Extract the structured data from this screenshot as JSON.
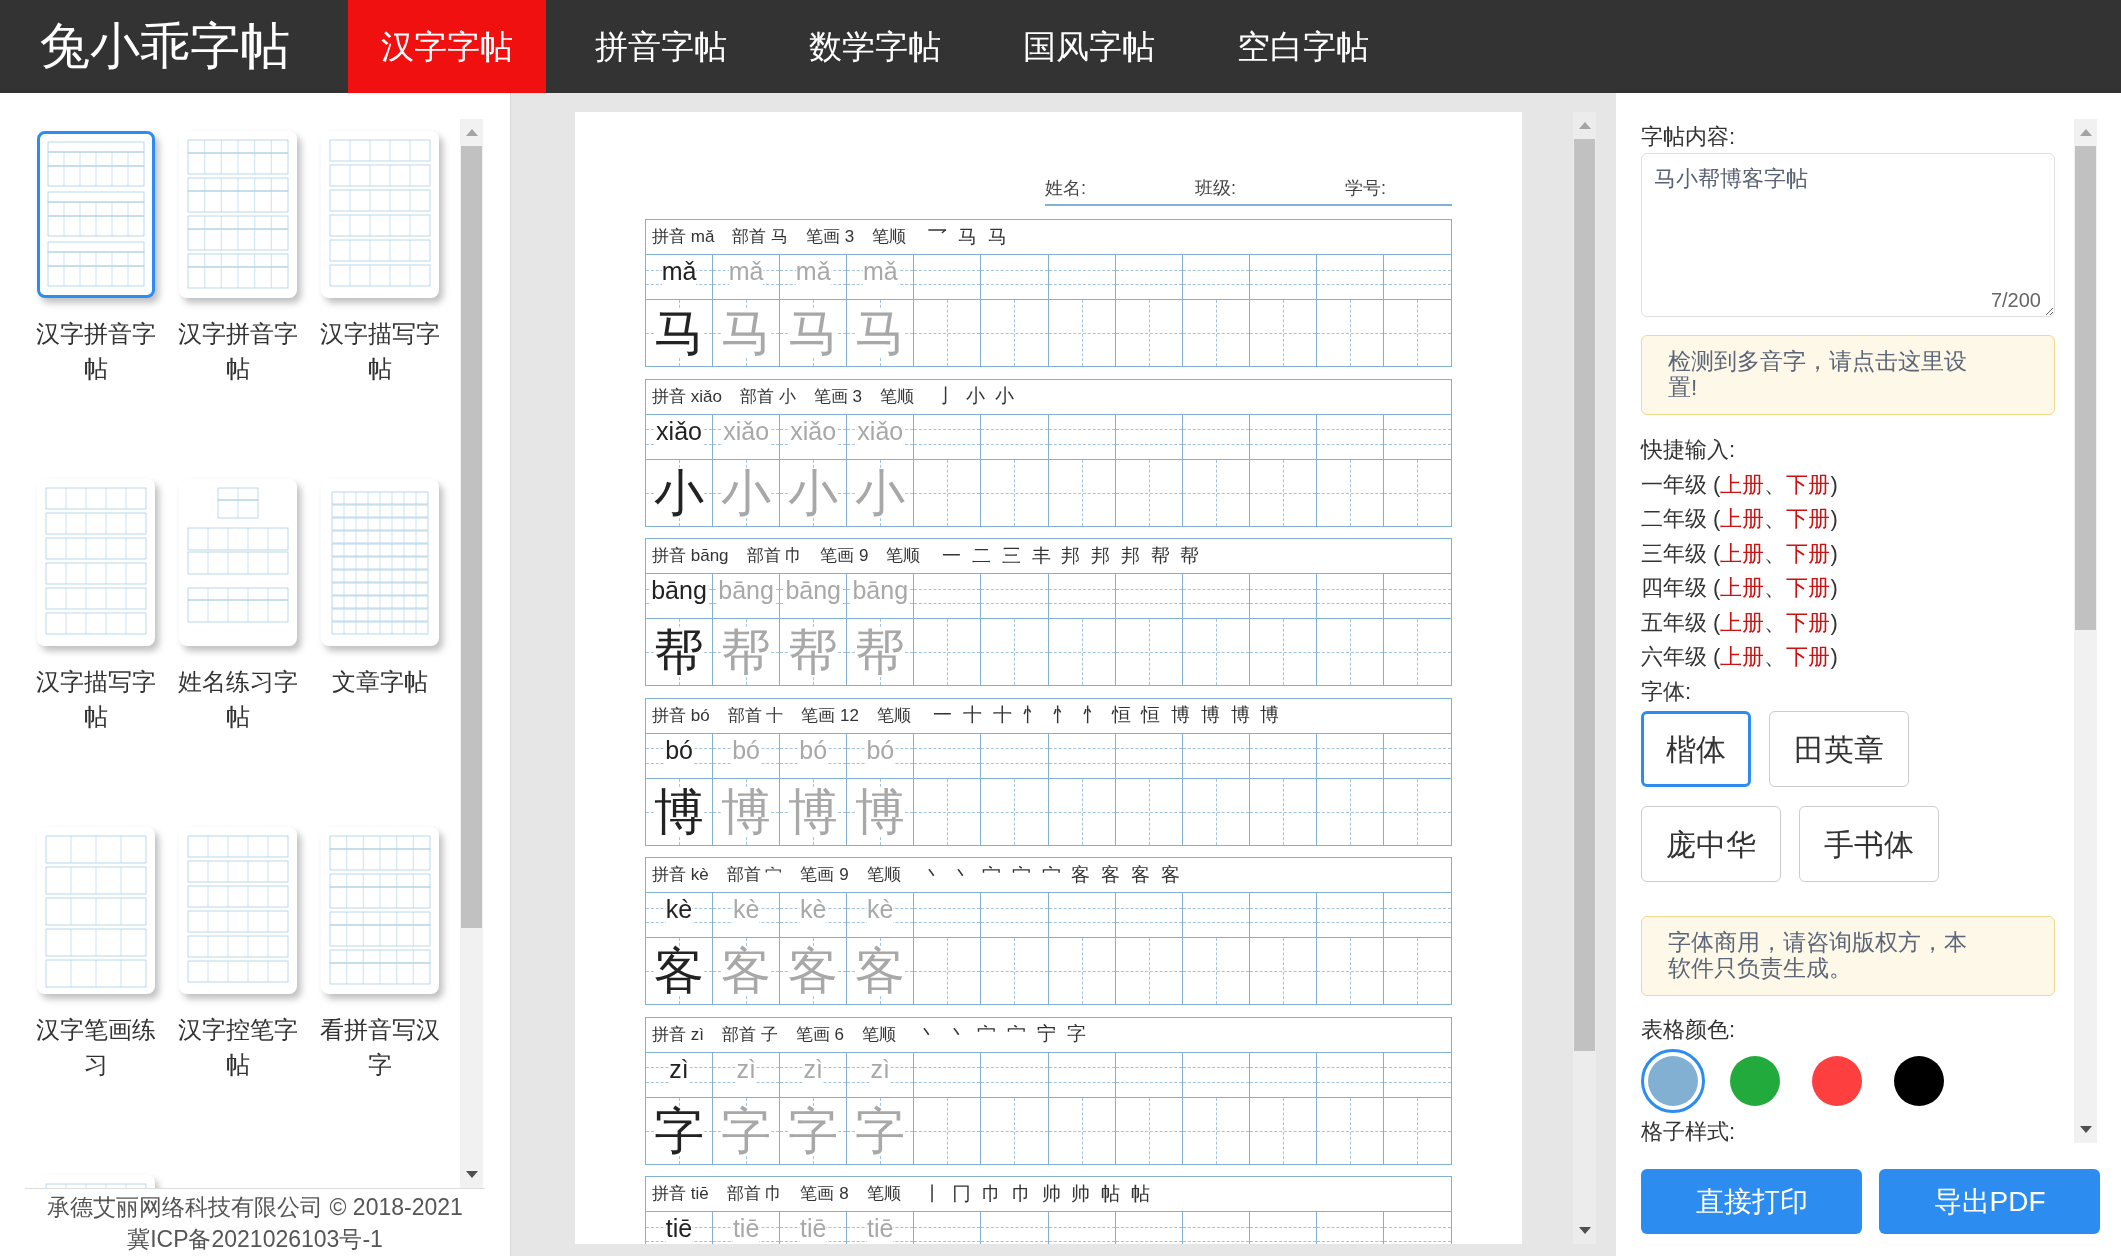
{
  "nav": {
    "logo": "兔小乖字帖",
    "tabs": [
      {
        "label": "汉字字帖",
        "selected": true
      },
      {
        "label": "拼音字帖",
        "selected": false
      },
      {
        "label": "数学字帖",
        "selected": false
      },
      {
        "label": "国风字帖",
        "selected": false
      },
      {
        "label": "空白字帖",
        "selected": false
      }
    ]
  },
  "templates": [
    {
      "label": "汉字拼音字帖",
      "kind": "pinyin-header",
      "selected": true
    },
    {
      "label": "汉字拼音字帖",
      "kind": "pinyin",
      "selected": false
    },
    {
      "label": "汉字描写字帖",
      "kind": "trace",
      "selected": false
    },
    {
      "label": "汉字描写字帖",
      "kind": "trace",
      "selected": false
    },
    {
      "label": "姓名练习字帖",
      "kind": "name",
      "selected": false
    },
    {
      "label": "文章字帖",
      "kind": "article",
      "selected": false
    },
    {
      "label": "汉字笔画练习",
      "kind": "stroke",
      "selected": false
    },
    {
      "label": "汉字控笔字帖",
      "kind": "trace",
      "selected": false
    },
    {
      "label": "看拼音写汉字",
      "kind": "pinyin",
      "selected": false
    },
    {
      "kind": "trace",
      "selected": false
    }
  ],
  "footer": [
    "承德艾丽网络科技有限公司 © 2018-2021",
    "冀ICP备2021026103号-1"
  ],
  "sheet": {
    "fields": [
      "姓名:",
      "班级:",
      "学号:"
    ],
    "blocks": [
      {
        "info": [
          "拼音 mǎ",
          "部首 马",
          "笔画 3",
          "笔顺"
        ],
        "stroke_order": "乛 马 马",
        "cells": [
          {
            "kind": "model",
            "pinyin": "mǎ",
            "char": "马"
          },
          {
            "kind": "trace",
            "pinyin": "mǎ",
            "char": "马"
          },
          {
            "kind": "trace",
            "pinyin": "mǎ",
            "char": "马"
          },
          {
            "kind": "trace",
            "pinyin": "mǎ",
            "char": "马"
          }
        ]
      },
      {
        "info": [
          "拼音 xiǎo",
          "部首 小",
          "笔画 3",
          "笔顺"
        ],
        "stroke_order": "亅 小 小",
        "cells": [
          {
            "kind": "model",
            "pinyin": "xiǎo",
            "char": "小"
          },
          {
            "kind": "trace",
            "pinyin": "xiǎo",
            "char": "小"
          },
          {
            "kind": "trace",
            "pinyin": "xiǎo",
            "char": "小"
          },
          {
            "kind": "trace",
            "pinyin": "xiǎo",
            "char": "小"
          }
        ]
      },
      {
        "info": [
          "拼音 bāng",
          "部首 巾",
          "笔画 9",
          "笔顺"
        ],
        "stroke_order": "一 二 三 丰 邦 邦 邦 帮 帮",
        "cells": [
          {
            "kind": "model",
            "pinyin": "bāng",
            "char": "帮"
          },
          {
            "kind": "trace",
            "pinyin": "bāng",
            "char": "帮"
          },
          {
            "kind": "trace",
            "pinyin": "bāng",
            "char": "帮"
          },
          {
            "kind": "trace",
            "pinyin": "bāng",
            "char": "帮"
          }
        ]
      },
      {
        "info": [
          "拼音 bó",
          "部首 十",
          "笔画 12",
          "笔顺"
        ],
        "stroke_order": "一 十 十 忄 忄 忄 恒 恒 博 博 博 博",
        "cells": [
          {
            "kind": "model",
            "pinyin": "bó",
            "char": "博"
          },
          {
            "kind": "trace",
            "pinyin": "bó",
            "char": "博"
          },
          {
            "kind": "trace",
            "pinyin": "bó",
            "char": "博"
          },
          {
            "kind": "trace",
            "pinyin": "bó",
            "char": "博"
          }
        ]
      },
      {
        "info": [
          "拼音 kè",
          "部首 宀",
          "笔画 9",
          "笔顺"
        ],
        "stroke_order": "丶 丶 宀 宀 宀 客 客 客 客",
        "cells": [
          {
            "kind": "model",
            "pinyin": "kè",
            "char": "客"
          },
          {
            "kind": "trace",
            "pinyin": "kè",
            "char": "客"
          },
          {
            "kind": "trace",
            "pinyin": "kè",
            "char": "客"
          },
          {
            "kind": "trace",
            "pinyin": "kè",
            "char": "客"
          }
        ]
      },
      {
        "info": [
          "拼音 zì",
          "部首 子",
          "笔画 6",
          "笔顺"
        ],
        "stroke_order": "丶 丶 宀 宀 宁 字",
        "cells": [
          {
            "kind": "model",
            "pinyin": "zì",
            "char": "字"
          },
          {
            "kind": "trace",
            "pinyin": "zì",
            "char": "字"
          },
          {
            "kind": "trace",
            "pinyin": "zì",
            "char": "字"
          },
          {
            "kind": "trace",
            "pinyin": "zì",
            "char": "字"
          }
        ]
      },
      {
        "info": [
          "拼音 tiē",
          "部首 巾",
          "笔画 8",
          "笔顺"
        ],
        "stroke_order": "丨 冂 巾 巾 帅 帅 帖 帖",
        "cells": [
          {
            "kind": "model",
            "pinyin": "tiē"
          },
          {
            "kind": "trace",
            "pinyin": "tiē"
          },
          {
            "kind": "trace",
            "pinyin": "tiē"
          },
          {
            "kind": "trace",
            "pinyin": "tiē"
          }
        ]
      }
    ]
  },
  "settings": {
    "content_label": "字帖内容:",
    "content": {
      "value": "马小帮博客字帖",
      "counter": "7/200"
    },
    "polyphone_alert": "检测到多音字，请点击这里设置!",
    "shortcut_label": "快捷输入:",
    "shortcuts": [
      [
        {
          "kind": "text",
          "text": "一年级 ("
        },
        {
          "kind": "link",
          "text": "上册"
        },
        {
          "kind": "text",
          "text": "、"
        },
        {
          "kind": "link",
          "text": "下册"
        },
        {
          "kind": "text",
          "text": ")"
        }
      ],
      [
        {
          "kind": "text",
          "text": "二年级 ("
        },
        {
          "kind": "link",
          "text": "上册"
        },
        {
          "kind": "text",
          "text": "、"
        },
        {
          "kind": "link",
          "text": "下册"
        },
        {
          "kind": "text",
          "text": ")"
        }
      ],
      [
        {
          "kind": "text",
          "text": "三年级 ("
        },
        {
          "kind": "link",
          "text": "上册"
        },
        {
          "kind": "text",
          "text": "、"
        },
        {
          "kind": "link",
          "text": "下册"
        },
        {
          "kind": "text",
          "text": ")"
        }
      ],
      [
        {
          "kind": "text",
          "text": "四年级 ("
        },
        {
          "kind": "link",
          "text": "上册"
        },
        {
          "kind": "text",
          "text": "、"
        },
        {
          "kind": "link",
          "text": "下册"
        },
        {
          "kind": "text",
          "text": ")"
        }
      ],
      [
        {
          "kind": "text",
          "text": "五年级 ("
        },
        {
          "kind": "link",
          "text": "上册"
        },
        {
          "kind": "text",
          "text": "、"
        },
        {
          "kind": "link",
          "text": "下册"
        },
        {
          "kind": "text",
          "text": ")"
        }
      ],
      [
        {
          "kind": "text",
          "text": "六年级 ("
        },
        {
          "kind": "link",
          "text": "上册"
        },
        {
          "kind": "text",
          "text": "、"
        },
        {
          "kind": "link",
          "text": "下册"
        },
        {
          "kind": "text",
          "text": ")"
        }
      ]
    ],
    "font_label": "字体:",
    "fonts": [
      {
        "label": "楷体",
        "selected": true
      },
      {
        "label": "田英章",
        "selected": false
      },
      {
        "label": "庞中华",
        "selected": false
      },
      {
        "label": "手书体",
        "selected": false
      }
    ],
    "font_notice": "字体商用，请咨询版权方，本软件只负责生成。",
    "color_label": "表格颜色:",
    "colors": [
      {
        "color": "#82b0d2",
        "selected": true
      },
      {
        "color": "#22aa3c",
        "selected": false
      },
      {
        "color": "#fd3f3f",
        "selected": false
      },
      {
        "color": "#000000",
        "selected": false
      }
    ],
    "style_label": "格子样式:"
  },
  "actions": [
    "直接打印",
    "导出PDF"
  ]
}
